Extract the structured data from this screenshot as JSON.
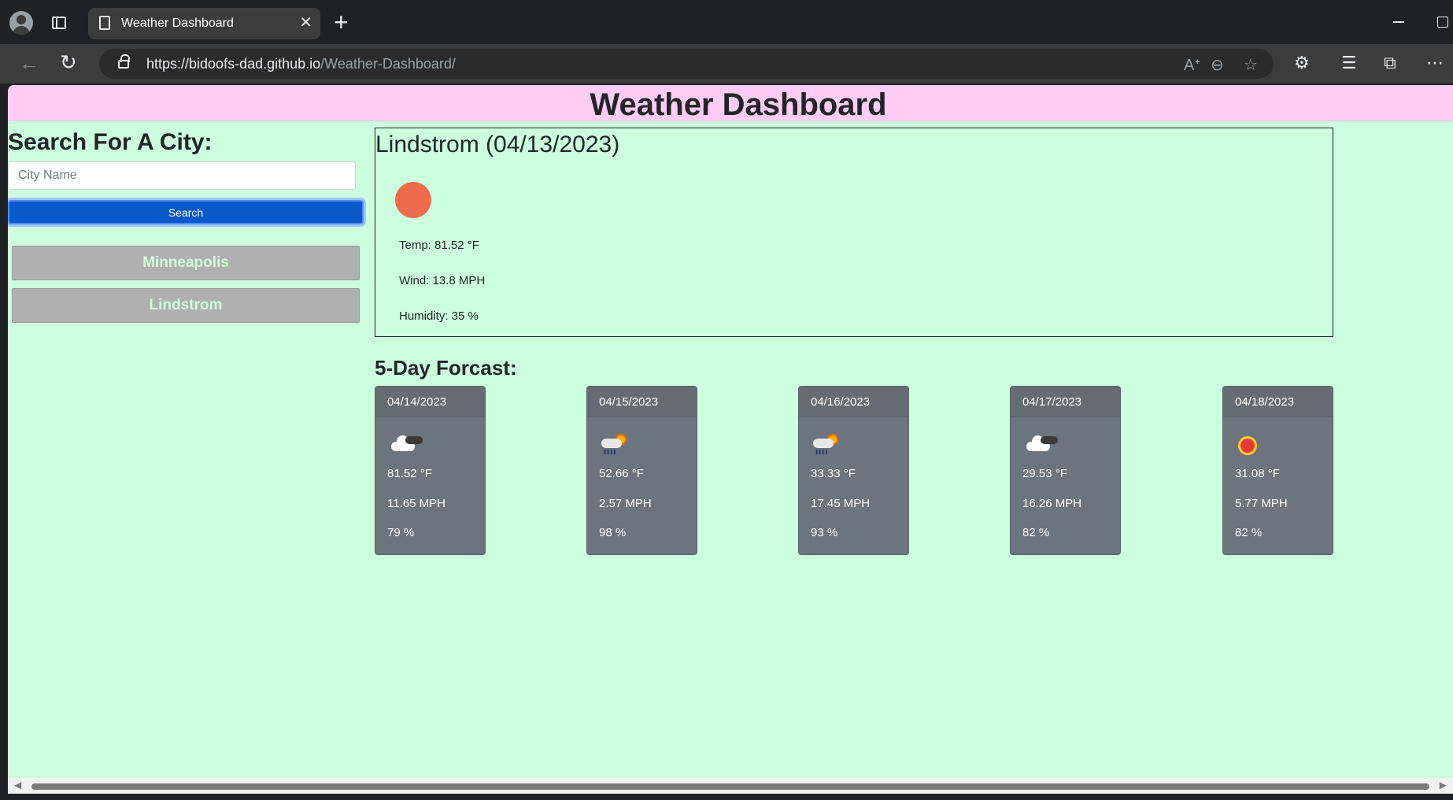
{
  "browser": {
    "tab_title": "Weather Dashboard",
    "url_host": "https://bidoofs-dad.github.io",
    "url_path": "/Weather-Dashboard/",
    "tab_close_glyph": "✕",
    "new_tab_glyph": "+",
    "back_glyph": "←",
    "reload_glyph": "↻",
    "read_aloud_glyph": "Aᐩ",
    "zoom_glyph": "⊖",
    "favorite_glyph": "☆",
    "extensions_glyph": "⚙",
    "favorites_glyph": "☰",
    "collections_glyph": "⧉",
    "more_glyph": "⋯"
  },
  "header": {
    "title": "Weather Dashboard"
  },
  "search": {
    "heading": "Search For A City:",
    "placeholder": "City Name",
    "button_label": "Search",
    "history": [
      "Minneapolis",
      "Lindstrom"
    ]
  },
  "current": {
    "title": "Lindstrom (04/13/2023)",
    "temp": "Temp: 81.52 °F",
    "wind": "Wind: 13.8 MPH",
    "humidity": "Humidity: 35 %"
  },
  "forecast": {
    "heading": "5-Day Forcast:",
    "days": [
      {
        "date": "04/14/2023",
        "icon": "cloudy-icon",
        "temp": "81.52 °F",
        "wind": "11.65 MPH",
        "humidity": "79 %"
      },
      {
        "date": "04/15/2023",
        "icon": "rain-sun-icon",
        "temp": "52.66 °F",
        "wind": "2.57 MPH",
        "humidity": "98 %"
      },
      {
        "date": "04/16/2023",
        "icon": "rain-sun-icon",
        "temp": "33.33 °F",
        "wind": "17.45 MPH",
        "humidity": "93 %"
      },
      {
        "date": "04/17/2023",
        "icon": "cloudy-icon",
        "temp": "29.53 °F",
        "wind": "16.26 MPH",
        "humidity": "82 %"
      },
      {
        "date": "04/18/2023",
        "icon": "sun-icon",
        "temp": "31.08 °F",
        "wind": "5.77 MPH",
        "humidity": "82 %"
      }
    ]
  },
  "colors": {
    "page_bg": "#ccffdd",
    "header_bg": "#ffccf5",
    "search_button": "#0a58ca",
    "history_button": "#b0b0b0",
    "card_bg": "#6c757d",
    "current_icon": "#ee6c4d"
  }
}
